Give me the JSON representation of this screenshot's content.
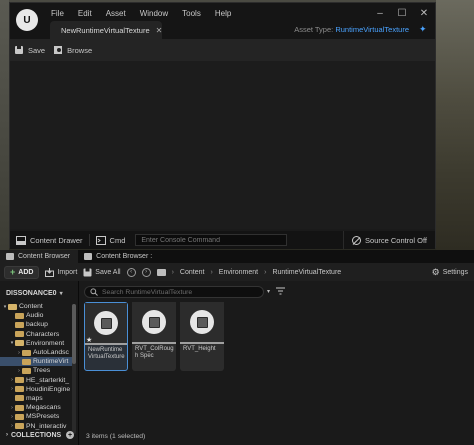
{
  "editor": {
    "menu": [
      "File",
      "Edit",
      "Asset",
      "Window",
      "Tools",
      "Help"
    ],
    "tab_label": "NewRuntimeVirtualTexture",
    "asset_type_label": "Asset Type:",
    "asset_type_value": "RuntimeVirtualTexture",
    "toolbar": {
      "save_label": "Save",
      "browse_label": "Browse"
    },
    "statusbar": {
      "content_drawer_label": "Content Drawer",
      "cmd_label": "Cmd",
      "console_placeholder": "Enter Console Command",
      "source_control_label": "Source Control Off"
    }
  },
  "content_browser": {
    "tabs": [
      "Content Browser",
      "Content Browser :"
    ],
    "toolbar": {
      "add_label": "ADD",
      "import_label": "Import",
      "save_all_label": "Save All",
      "settings_label": "Settings"
    },
    "breadcrumb": [
      "Content",
      "Environment",
      "RuntimeVirtualTexture"
    ],
    "tree_header": "DISSONANCE0",
    "tree": [
      {
        "label": "Content",
        "indent": 0,
        "expander": "▾",
        "open": true
      },
      {
        "label": "Audio",
        "indent": 1,
        "expander": ""
      },
      {
        "label": "backup",
        "indent": 1,
        "expander": ""
      },
      {
        "label": "Characters",
        "indent": 1,
        "expander": ""
      },
      {
        "label": "Environment",
        "indent": 1,
        "expander": "▾",
        "open": true
      },
      {
        "label": "AutoLandsc",
        "indent": 2,
        "expander": "›"
      },
      {
        "label": "RuntimeVirt",
        "indent": 2,
        "expander": "",
        "selected": true
      },
      {
        "label": "Trees",
        "indent": 2,
        "expander": "›"
      },
      {
        "label": "HE_starterkit_",
        "indent": 1,
        "expander": "›"
      },
      {
        "label": "HoudiniEngine",
        "indent": 1,
        "expander": "›"
      },
      {
        "label": "maps",
        "indent": 1,
        "expander": ""
      },
      {
        "label": "Megascans",
        "indent": 1,
        "expander": "›"
      },
      {
        "label": "MSPresets",
        "indent": 1,
        "expander": "›"
      },
      {
        "label": "PN_interactiv",
        "indent": 1,
        "expander": "›"
      }
    ],
    "collections_label": "COLLECTIONS",
    "search_placeholder": "Search RuntimeVirtualTexture",
    "assets": [
      {
        "label": "NewRuntime VirtualTexture",
        "selected": true,
        "starred": true
      },
      {
        "label": "RVT_ColRough Spec",
        "selected": false,
        "starred": false
      },
      {
        "label": "RVT_Height",
        "selected": false,
        "starred": false
      }
    ],
    "item_count": "3 items (1 selected)"
  }
}
